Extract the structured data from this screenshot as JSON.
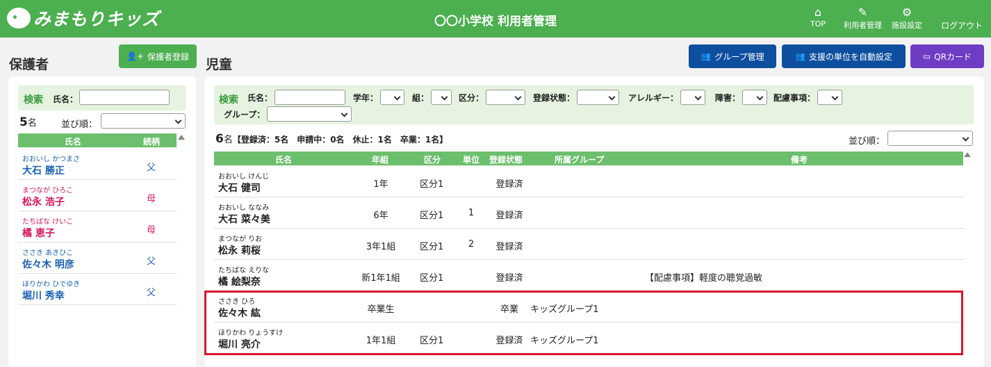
{
  "header": {
    "logo_text": "みまもりキッズ",
    "title": "〇〇小学校 利用者管理",
    "nav": [
      {
        "icon": "home-icon",
        "label": "TOP"
      },
      {
        "icon": "user-edit-icon",
        "label": "利用者管理"
      },
      {
        "icon": "gear-icon",
        "label": "施設設定"
      }
    ],
    "logout": "ログアウト"
  },
  "guardians": {
    "title": "保護者",
    "register_button": "保護者登録",
    "search_label": "検索",
    "name_label": "氏名：",
    "count": "5",
    "count_unit": "名",
    "sort_label": "並び順：",
    "col_name": "氏名",
    "col_relation": "続柄",
    "rows": [
      {
        "kana": "おおいし かつまさ",
        "name": "大石 勝正",
        "relation": "父",
        "color": "#1a62b0"
      },
      {
        "kana": "まつなが ひろこ",
        "name": "松永 浩子",
        "relation": "母",
        "color": "#d6165c"
      },
      {
        "kana": "たちばな けいこ",
        "name": "橘 恵子",
        "relation": "母",
        "color": "#d6165c"
      },
      {
        "kana": "ささき あきひこ",
        "name": "佐々木 明彦",
        "relation": "父",
        "color": "#1a62b0"
      },
      {
        "kana": "ほりかわ ひでゆき",
        "name": "堀川 秀幸",
        "relation": "父",
        "color": "#1a62b0"
      }
    ]
  },
  "children": {
    "title": "児童",
    "buttons": {
      "group": "グループ管理",
      "auto_unit": "支援の単位を自動設定",
      "qr": "QRカード"
    },
    "search": {
      "label": "検索",
      "name": "氏名：",
      "grade": "学年：",
      "class": "組：",
      "kubun": "区分：",
      "status": "登録状態：",
      "allergy": "アレルギー：",
      "disability": "障害：",
      "consideration": "配慮事項：",
      "group": "グループ："
    },
    "count": "6",
    "count_unit": "名",
    "summary": "【登録済：5名　申請中：0名　休止：1名　卒業：1名】",
    "sort_label": "並び順：",
    "columns": {
      "name": "氏名",
      "grade": "年組",
      "kubun": "区分",
      "unit": "単位",
      "status": "登録状態",
      "group": "所属グループ",
      "note": "備考"
    },
    "rows": [
      {
        "kana": "おおいし けんじ",
        "name": "大石 健司",
        "grade": "1年",
        "kubun": "区分1",
        "unit": "",
        "status": "登録済",
        "group": "",
        "note": ""
      },
      {
        "kana": "おおいし ななみ",
        "name": "大石 菜々美",
        "grade": "6年",
        "kubun": "区分1",
        "unit": "1",
        "status": "登録済",
        "group": "",
        "note": ""
      },
      {
        "kana": "まつなが りお",
        "name": "松永 莉桜",
        "grade": "3年1組",
        "kubun": "区分1",
        "unit": "2",
        "status": "登録済",
        "group": "",
        "note": ""
      },
      {
        "kana": "たちばな えりな",
        "name": "橘 絵梨奈",
        "grade": "新1年1組",
        "kubun": "区分1",
        "unit": "",
        "status": "登録済",
        "group": "",
        "note": "【配慮事項】軽度の聴覚過敏"
      },
      {
        "kana": "ささき ひろ",
        "name": "佐々木 紘",
        "grade": "卒業生",
        "kubun": "",
        "unit": "",
        "status": "卒業",
        "group": "キッズグループ1",
        "note": ""
      },
      {
        "kana": "ほりかわ りょうすけ",
        "name": "堀川 亮介",
        "grade": "1年1組",
        "kubun": "区分1",
        "unit": "",
        "status": "登録済",
        "group": "キッズグループ1",
        "note": ""
      }
    ]
  },
  "colors": {
    "header_green": "#4caf50",
    "table_head_green": "#6cbf6c",
    "button_blue": "#0d4f9e",
    "button_purple": "#6f3cc4",
    "highlight_red": "#d6162d"
  }
}
